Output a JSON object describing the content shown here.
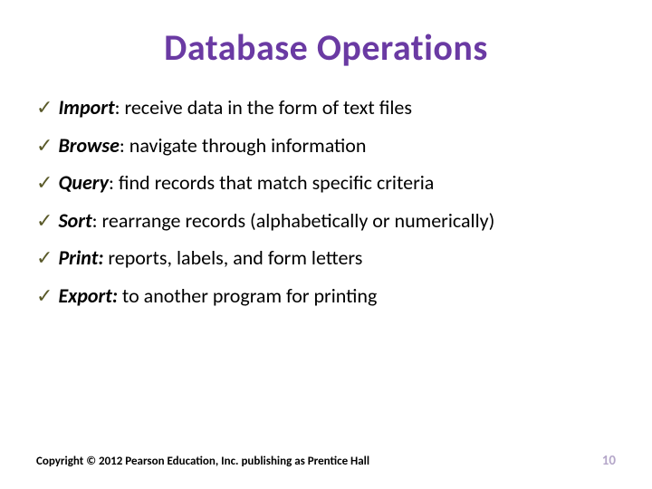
{
  "title": "Database Operations",
  "items": [
    {
      "term": "Import",
      "sep": ": ",
      "desc": "receive data in the form of text files"
    },
    {
      "term": "Browse",
      "sep": ": ",
      "desc": "navigate through information"
    },
    {
      "term": "Query",
      "sep": ": ",
      "desc": "find records that match specific criteria"
    },
    {
      "term": "Sort",
      "sep": ": ",
      "desc": "rearrange records (alphabetically or numerically)"
    },
    {
      "term": "Print:",
      "sep": " ",
      "desc": "reports, labels, and form letters"
    },
    {
      "term": "Export:",
      "sep": " ",
      "desc": "to another program for printing"
    }
  ],
  "checkmark": "✓",
  "copyright": "Copyright © 2012 Pearson Education, Inc. publishing as Prentice Hall",
  "pageNumber": "10"
}
